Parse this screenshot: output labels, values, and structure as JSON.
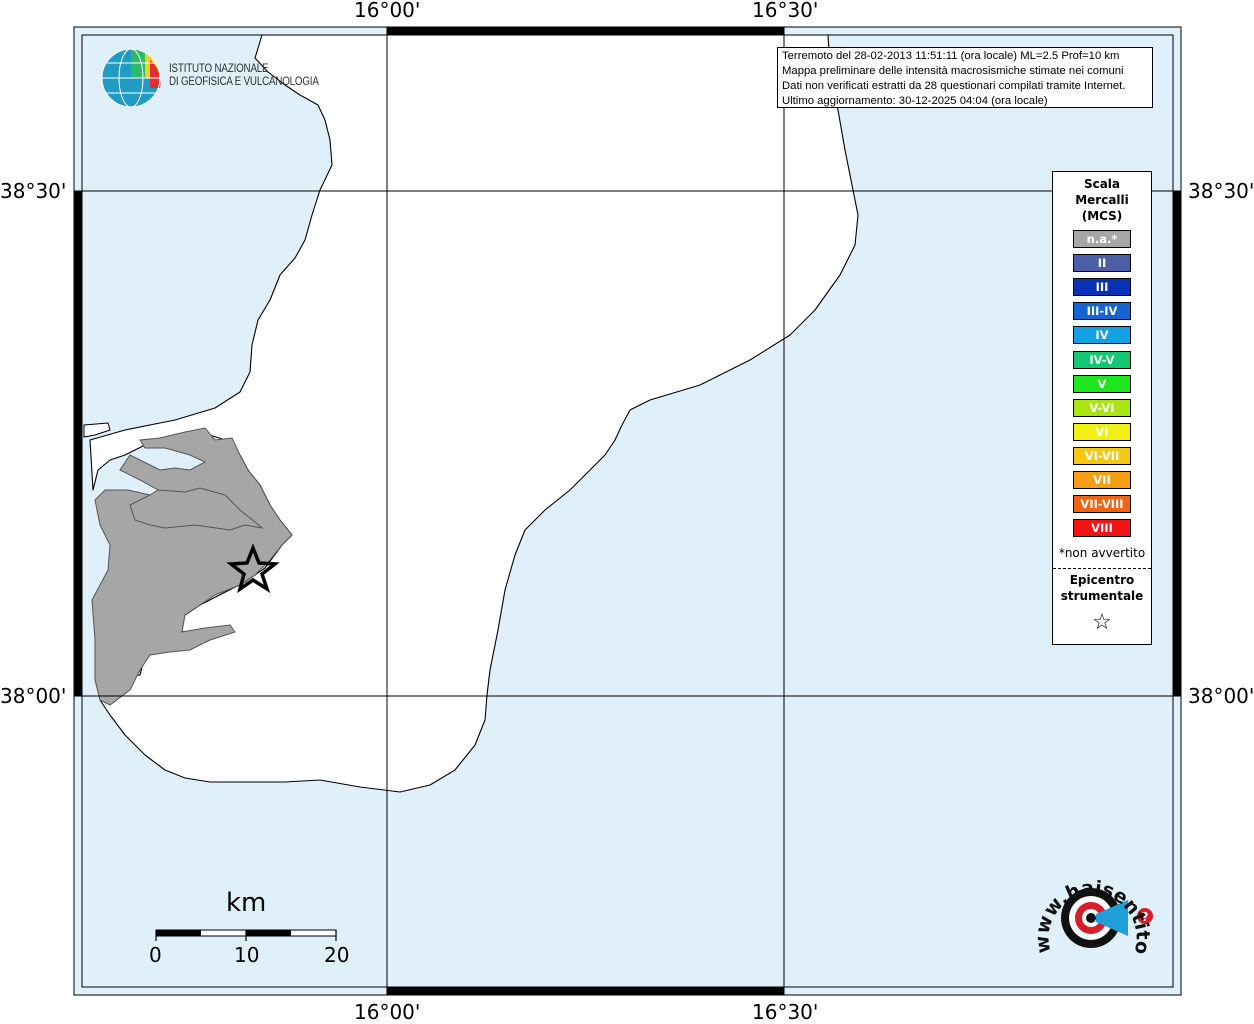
{
  "map": {
    "top_labels": [
      "16°00'",
      "16°30'"
    ],
    "bottom_labels": [
      "16°00'",
      "16°30'"
    ],
    "left_labels": [
      "38°30'",
      "38°00'"
    ],
    "right_labels": [
      "38°30'",
      "38°00'"
    ],
    "colors": {
      "sea": "#dff0fb",
      "land": "#ffffff",
      "felt_area": "#a6a6a6",
      "coast": "#000000"
    }
  },
  "info": {
    "line1": "Terremoto del 28-02-2013 11:51:11 (ora locale) ML=2.5 Prof=10 km",
    "line2": "Mappa preliminare delle intensità macrosismiche stimate nei comuni",
    "line3": "Dati non verificati estratti da 28 questionari compilati tramite Internet.",
    "line4": "Ultimo aggiornamento: 30-12-2025 04:04 (ora locale)"
  },
  "logo": {
    "line1": "ISTITUTO NAZIONALE",
    "line2": "DI GEOFISICA E VULCANOLOGIA",
    "icon": "ingv-globe-icon"
  },
  "legend": {
    "title1": "Scala",
    "title2": "Mercalli",
    "title3": "(MCS)",
    "items": [
      {
        "label": "n.a.*",
        "color": "#a6a6a6"
      },
      {
        "label": "II",
        "color": "#4a5fa8"
      },
      {
        "label": "III",
        "color": "#0a32b4"
      },
      {
        "label": "III-IV",
        "color": "#1464d2"
      },
      {
        "label": "IV",
        "color": "#14a0e6"
      },
      {
        "label": "IV-V",
        "color": "#14c873"
      },
      {
        "label": "V",
        "color": "#1ee61e"
      },
      {
        "label": "V-VI",
        "color": "#aae614"
      },
      {
        "label": "VI",
        "color": "#f0f014"
      },
      {
        "label": "VI-VII",
        "color": "#f5c814"
      },
      {
        "label": "VII",
        "color": "#f5a014"
      },
      {
        "label": "VII-VIII",
        "color": "#f06414"
      },
      {
        "label": "VIII",
        "color": "#f01414"
      }
    ],
    "note": "*non avvertito",
    "epicenter1": "Epicentro",
    "epicenter2": "strumentale",
    "star": "☆"
  },
  "scale": {
    "title": "km",
    "labels": [
      "0",
      "10",
      "20"
    ]
  },
  "badge": {
    "text": "www.haisentitoilterremoto.it",
    "icon": "megaphone-icon"
  }
}
